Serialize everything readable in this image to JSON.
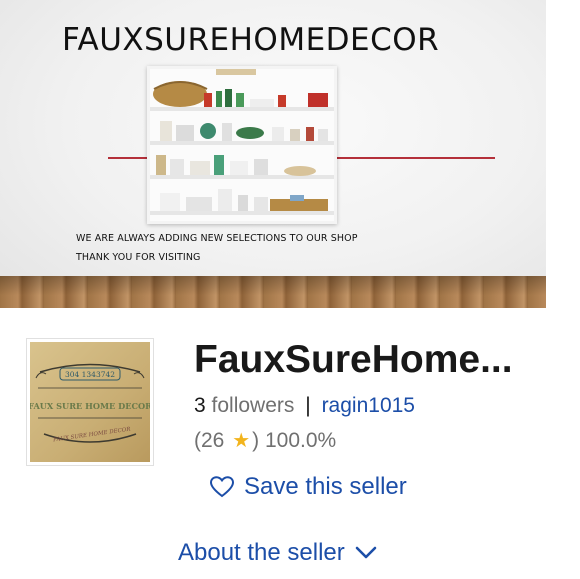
{
  "banner": {
    "title": "FAUXSUREHOMEDECOR",
    "message_line1": "WE ARE ALWAYS ADDING NEW SELECTIONS TO OUR SHOP",
    "message_line2": "THANK YOU FOR VISITING"
  },
  "logo": {
    "top_text": "304 1343742",
    "main_text": "FAUX SURE HOME DECOR",
    "sub_text": "FAUX SURE HOME DECOR"
  },
  "seller": {
    "store_name": "FauxSureHome...",
    "followers_count": "3",
    "followers_label": "followers",
    "username": "ragin1015",
    "feedback_open": "(26",
    "feedback_close": ")",
    "feedback_percent": "100.0%"
  },
  "actions": {
    "save_seller": "Save this seller",
    "about_seller": "About the seller"
  },
  "colors": {
    "link": "#1c4ea8",
    "star": "#f2b41d",
    "accent_line": "#b4303a"
  },
  "icons": {
    "save": "heart-outline-icon",
    "about": "chevron-down-icon",
    "rating": "star-icon"
  }
}
